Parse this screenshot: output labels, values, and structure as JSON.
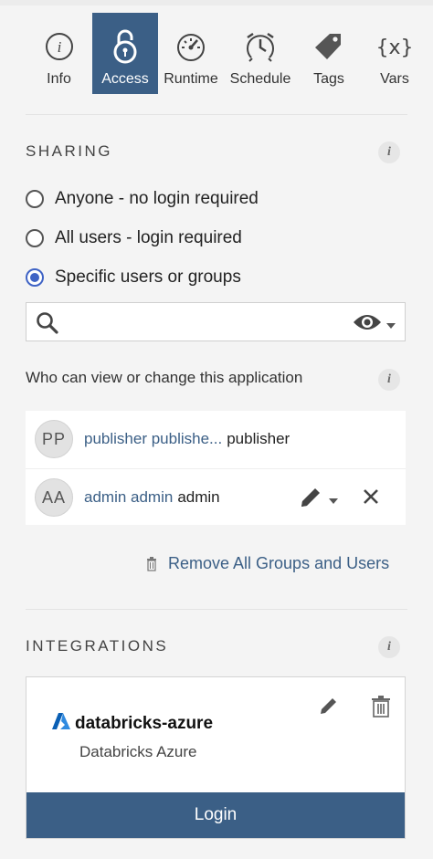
{
  "tabs": [
    {
      "label": "Info",
      "icon": "info-icon",
      "active": false
    },
    {
      "label": "Access",
      "icon": "lock-icon",
      "active": true
    },
    {
      "label": "Runtime",
      "icon": "gauge-icon",
      "active": false
    },
    {
      "label": "Schedule",
      "icon": "clock-icon",
      "active": false
    },
    {
      "label": "Tags",
      "icon": "tag-icon",
      "active": false
    },
    {
      "label": "Vars",
      "icon": "variables-icon",
      "active": false
    }
  ],
  "sharing": {
    "title": "SHARING",
    "options": [
      {
        "label": "Anyone - no login required",
        "selected": false
      },
      {
        "label": "All users - login required",
        "selected": false
      },
      {
        "label": "Specific users or groups",
        "selected": true
      }
    ],
    "search": {
      "value": "",
      "placeholder": ""
    },
    "who_label": "Who can view or change this application",
    "users": [
      {
        "initials": "PP",
        "name": "publisher publishe...",
        "role": "publisher"
      },
      {
        "initials": "AA",
        "name": "admin admin",
        "role": "admin"
      }
    ],
    "remove_all_label": "Remove All Groups and Users"
  },
  "integrations": {
    "title": "INTEGRATIONS",
    "card": {
      "name": "databricks-azure",
      "description": "Databricks Azure",
      "login_label": "Login"
    }
  },
  "colors": {
    "accent": "#3b5f86",
    "radio_selected": "#3f63c5",
    "background": "#f4f4f4"
  }
}
